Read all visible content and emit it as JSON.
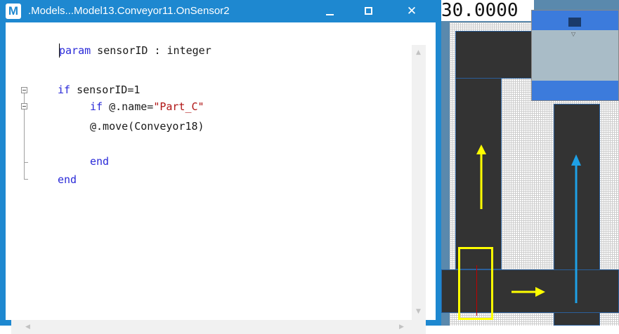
{
  "window": {
    "app_icon_letter": "M",
    "title": ".Models...Model13.Conveyor11.OnSensor2",
    "close_glyph": "✕"
  },
  "code": {
    "lines": {
      "param_kw": "param",
      "param_rest": " sensorID : integer",
      "if_kw": "if",
      "if_rest": " sensorID=1",
      "if2_kw": "if",
      "if2_mid": " @.name=",
      "if2_str": "\"Part_C\"",
      "move_line": "@.move(Conveyor18)",
      "end_inner": "end",
      "end_outer": "end"
    }
  },
  "simulation": {
    "time_display": "30.0000",
    "arrow_colors": {
      "annotation": "#ffff00",
      "flow": "#1ea0e6"
    }
  }
}
